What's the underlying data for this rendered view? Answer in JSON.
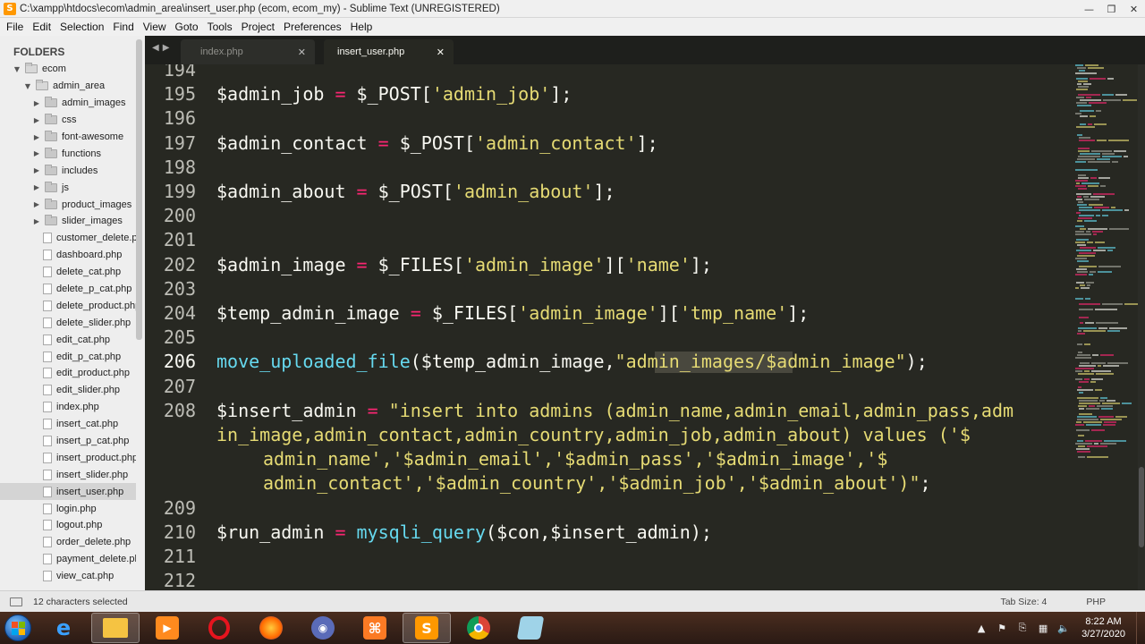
{
  "window": {
    "title": "C:\\xampp\\htdocs\\ecom\\admin_area\\insert_user.php (ecom, ecom_my) - Sublime Text (UNREGISTERED)",
    "app_icon": "S"
  },
  "menu": [
    "File",
    "Edit",
    "Selection",
    "Find",
    "View",
    "Goto",
    "Tools",
    "Project",
    "Preferences",
    "Help"
  ],
  "sidebar": {
    "title": "FOLDERS",
    "root": "ecom",
    "admin_folder": "admin_area",
    "folders": [
      "admin_images",
      "css",
      "font-awesome",
      "functions",
      "includes",
      "js",
      "product_images",
      "slider_images"
    ],
    "files": [
      "customer_delete.php",
      "dashboard.php",
      "delete_cat.php",
      "delete_p_cat.php",
      "delete_product.php",
      "delete_slider.php",
      "edit_cat.php",
      "edit_p_cat.php",
      "edit_product.php",
      "edit_slider.php",
      "index.php",
      "insert_cat.php",
      "insert_p_cat.php",
      "insert_product.php",
      "insert_slider.php",
      "insert_user.php",
      "login.php",
      "logout.php",
      "order_delete.php",
      "payment_delete.php",
      "view_cat.php"
    ],
    "selected_file": "insert_user.php"
  },
  "tabs": [
    {
      "label": "index.php",
      "active": false
    },
    {
      "label": "insert_user.php",
      "active": true
    }
  ],
  "editor": {
    "lines": [
      {
        "n": "194",
        "code": ""
      },
      {
        "n": "195",
        "code": "$admin_job = $_POST['admin_job'];"
      },
      {
        "n": "196",
        "code": ""
      },
      {
        "n": "197",
        "code": "$admin_contact = $_POST['admin_contact'];"
      },
      {
        "n": "198",
        "code": ""
      },
      {
        "n": "199",
        "code": "$admin_about = $_POST['admin_about'];"
      },
      {
        "n": "200",
        "code": ""
      },
      {
        "n": "201",
        "code": ""
      },
      {
        "n": "202",
        "code": "$admin_image = $_FILES['admin_image']['name'];"
      },
      {
        "n": "203",
        "code": ""
      },
      {
        "n": "204",
        "code": "$temp_admin_image = $_FILES['admin_image']['tmp_name'];"
      },
      {
        "n": "205",
        "code": ""
      },
      {
        "n": "206",
        "code": "move_uploaded_file($temp_admin_image,\"admin_images/$admin_image\");"
      },
      {
        "n": "207",
        "code": ""
      },
      {
        "n": "208",
        "code": "$insert_admin = \"insert into admins (admin_name,admin_email,admin_pass,admin_image,admin_contact,admin_country,admin_job,admin_about) values ('$admin_name','$admin_email','$admin_pass','$admin_image','$admin_contact','$admin_country','$admin_job','$admin_about')\";"
      },
      {
        "n": "209",
        "code": ""
      },
      {
        "n": "210",
        "code": "$run_admin = mysqli_query($con,$insert_admin);"
      },
      {
        "n": "211",
        "code": ""
      },
      {
        "n": "212",
        "code": ""
      }
    ],
    "wrap_208": [
      "$insert_admin = \"insert into admins (admin_name,admin_email,admin_pass,adm",
      "in_image,admin_contact,admin_country,admin_job,admin_about) values ('$",
      "admin_name','$admin_email','$admin_pass','$admin_image','$",
      "admin_contact','$admin_country','$admin_job','$admin_about')\";"
    ],
    "current_line": "206"
  },
  "status": {
    "selection": "12 characters selected",
    "tab_size": "Tab Size: 4",
    "syntax": "PHP"
  },
  "taskbar": {
    "apps": [
      "start",
      "internet-explorer",
      "file-explorer",
      "media-player",
      "opera",
      "firefox",
      "screen-recorder",
      "xampp",
      "sublime-text",
      "chrome",
      "notepad"
    ],
    "time": "8:22 AM",
    "date": "3/27/2020"
  },
  "colors": {
    "editor_bg": "#272822",
    "keyword": "#f92672",
    "string": "#e6db74",
    "function": "#66d9ef",
    "text": "#f8f8f2"
  }
}
